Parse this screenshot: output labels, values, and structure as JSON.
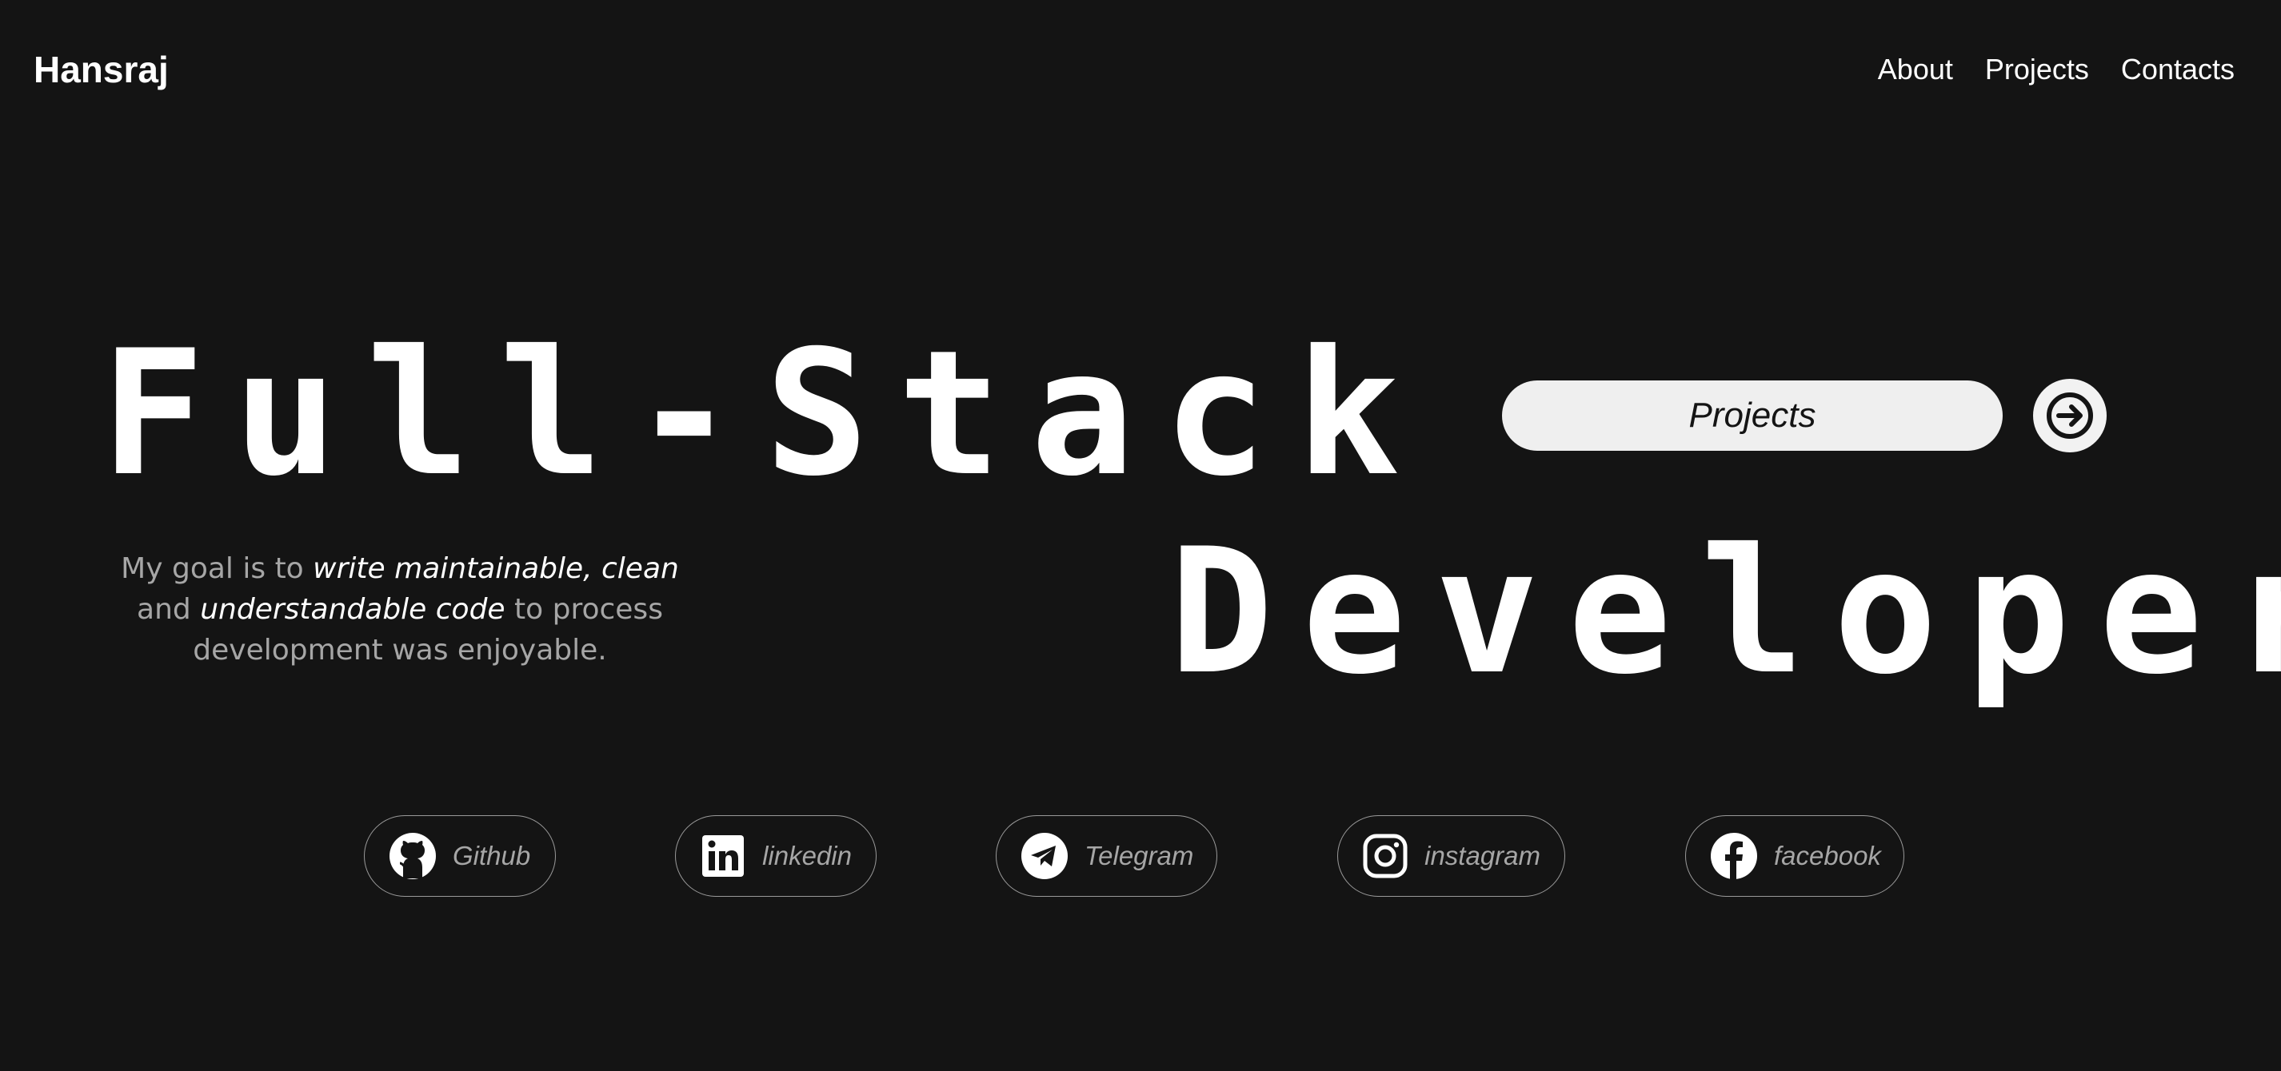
{
  "header": {
    "brand": "Hansraj",
    "nav": [
      "About",
      "Projects",
      "Contacts"
    ]
  },
  "hero": {
    "line1": "Full-Stack",
    "line2": "Developer",
    "tagline": {
      "p1": "My goal is to ",
      "em1": "write maintainable, clean",
      "p2": " and ",
      "em2": "understandable code",
      "p3": " to process development was enjoyable."
    },
    "cta_label": "Projects",
    "cta_arrow_icon": "arrow-right-icon"
  },
  "socials": [
    {
      "label": "Github",
      "icon": "github-icon"
    },
    {
      "label": "linkedin",
      "icon": "linkedin-icon"
    },
    {
      "label": "Telegram",
      "icon": "telegram-icon"
    },
    {
      "label": "instagram",
      "icon": "instagram-icon"
    },
    {
      "label": "facebook",
      "icon": "facebook-icon"
    }
  ],
  "colors": {
    "background": "#141414",
    "text": "#ffffff",
    "muted": "#a6a6a6",
    "button": "#efefef"
  }
}
